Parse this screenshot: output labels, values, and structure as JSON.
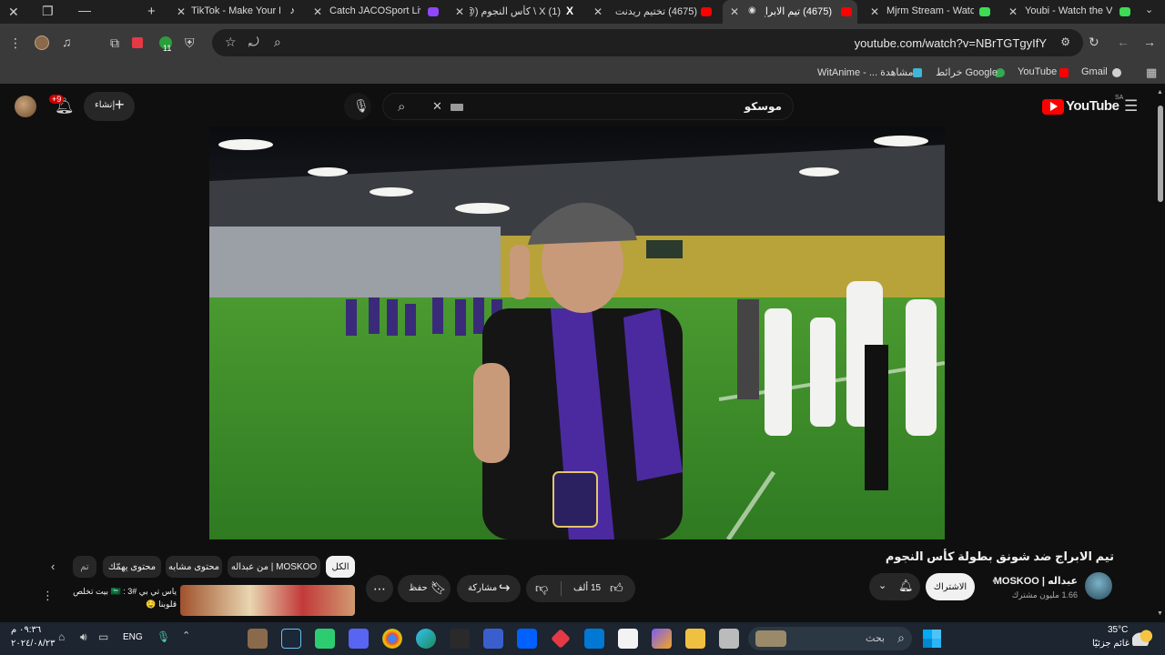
{
  "tabs": [
    {
      "title": "TikTok - Make Your D",
      "favicon": "tiktok-icon"
    },
    {
      "title": "Catch JACOSport Live",
      "favicon": "twitch-icon"
    },
    {
      "title": "(1) X \\ كأس النجوم (@",
      "favicon": "x-icon"
    },
    {
      "title": "(4675) تختيم ريدنت",
      "favicon": "youtube-icon"
    },
    {
      "title": "(4675) تيم الابراج",
      "favicon": "youtube-icon",
      "active": true
    },
    {
      "title": "Mjrm Stream - Watch",
      "favicon": "kick-icon"
    },
    {
      "title": "Youbi - Watch the VO",
      "favicon": "kick-icon"
    }
  ],
  "address": {
    "url": "youtube.com/watch?v=NBrTGTgyIfY"
  },
  "bookmarks": [
    {
      "label": "Gmail",
      "icon": "gmail-icon"
    },
    {
      "label": "YouTube",
      "icon": "youtube-icon"
    },
    {
      "label": "خرائط Google",
      "icon": "maps-icon"
    },
    {
      "label": "مشاهدة ... - WitAnime",
      "icon": "witanime-icon"
    }
  ],
  "yt_header": {
    "logo": "YouTube",
    "region": "SA",
    "search_value": "موسكو",
    "create_label": "إنشاء",
    "notif_badge": "+9"
  },
  "video": {
    "title": "تيم الابراج ضد شونق بطولة كأس النجوم"
  },
  "channel": {
    "name": "عبداله | MOSKOO",
    "subscribers": "1.66 مليون مشترك",
    "subscribe_label": "الاشتراك"
  },
  "actions": {
    "like_count": "15 ألف",
    "share_label": "مشاركة",
    "save_label": "حفظ"
  },
  "chips": [
    "الكل",
    "من عبداله | MOSKOO",
    "محتوى مشابه",
    "محتوى يهمّك",
    "تم"
  ],
  "recommendation": {
    "title": "ياس تي بي 🇸🇦 : 3# بيت تخلص",
    "subtitle": "قلوبنا 🤤"
  },
  "taskbar": {
    "weather_temp": "35°C",
    "weather_text": "غائم جزئيًا",
    "search_placeholder": "بحث",
    "lang": "ENG",
    "time": "٠٩:٣٦ م",
    "date": "٢٠٢٤/٠٨/٢٣"
  },
  "colors": {
    "yt_red": "#ff0000",
    "bg": "#0f0f0f",
    "chip_bg": "#272727",
    "scarf_purple": "#4b2aa0",
    "pitch_green": "#3f8f2c"
  }
}
